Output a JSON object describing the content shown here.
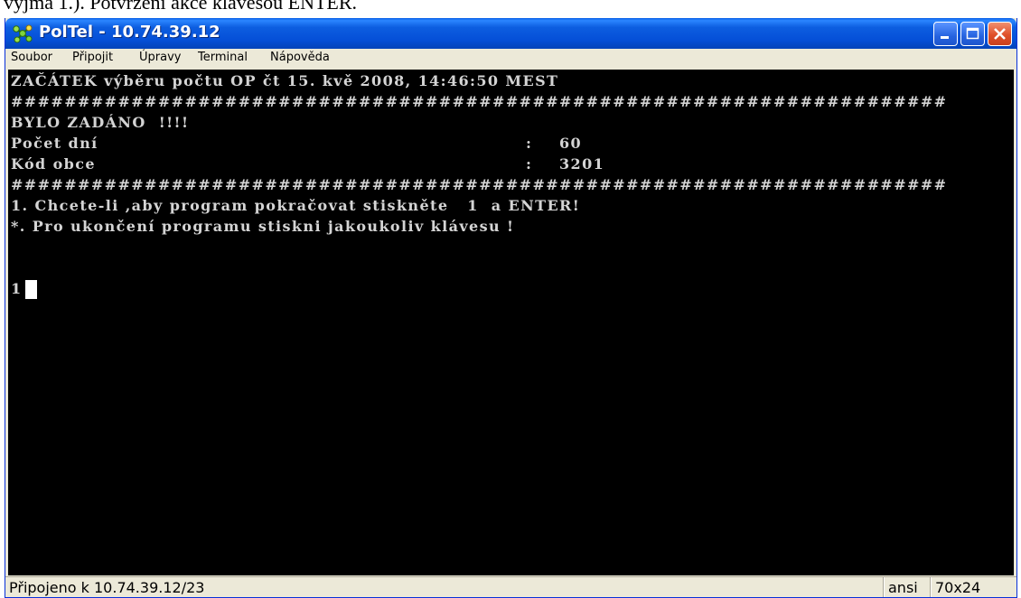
{
  "document_fragment": "výjma 1.). Potvrzení akce klávesou ENTER.",
  "window": {
    "title": "PolTel - 10.74.39.12",
    "title_icon": "poltel-network-icon",
    "controls": {
      "minimize_icon": "minimize-icon",
      "maximize_icon": "maximize-icon",
      "close_icon": "close-icon"
    }
  },
  "menu": {
    "items": [
      {
        "label": "Soubor"
      },
      {
        "label": "Připojit"
      },
      {
        "label": "Úpravy"
      },
      {
        "label": "Terminal"
      },
      {
        "label": "Nápověda"
      }
    ]
  },
  "terminal": {
    "header": "ZAČÁTEK výběru počtu OP čt 15. kvě 2008, 14:46:50 MEST",
    "separator": "######################################################################",
    "entered_notice": "BYLO ZADÁNO  !!!!",
    "fields": [
      {
        "label": "Počet dní",
        "separator": ":",
        "value": "60"
      },
      {
        "label": "Kód obce",
        "separator": ":",
        "value": "3201"
      }
    ],
    "option_continue": "1. Chcete-li ,aby program pokračovat stiskněte   1  a ENTER!",
    "option_quit": "*. Pro ukončení programu stiskni jakoukoliv klávesu !",
    "input_value": "1",
    "background_color": "#000000",
    "text_color": "#d4d4d4"
  },
  "status_bar": {
    "connection": "Připojeno k 10.74.39.12/23",
    "encoding": "ansi",
    "size": "70x24"
  },
  "colors": {
    "titlebar": "#0550d8",
    "close_button": "#e0502a",
    "chrome": "#ece9d8"
  }
}
